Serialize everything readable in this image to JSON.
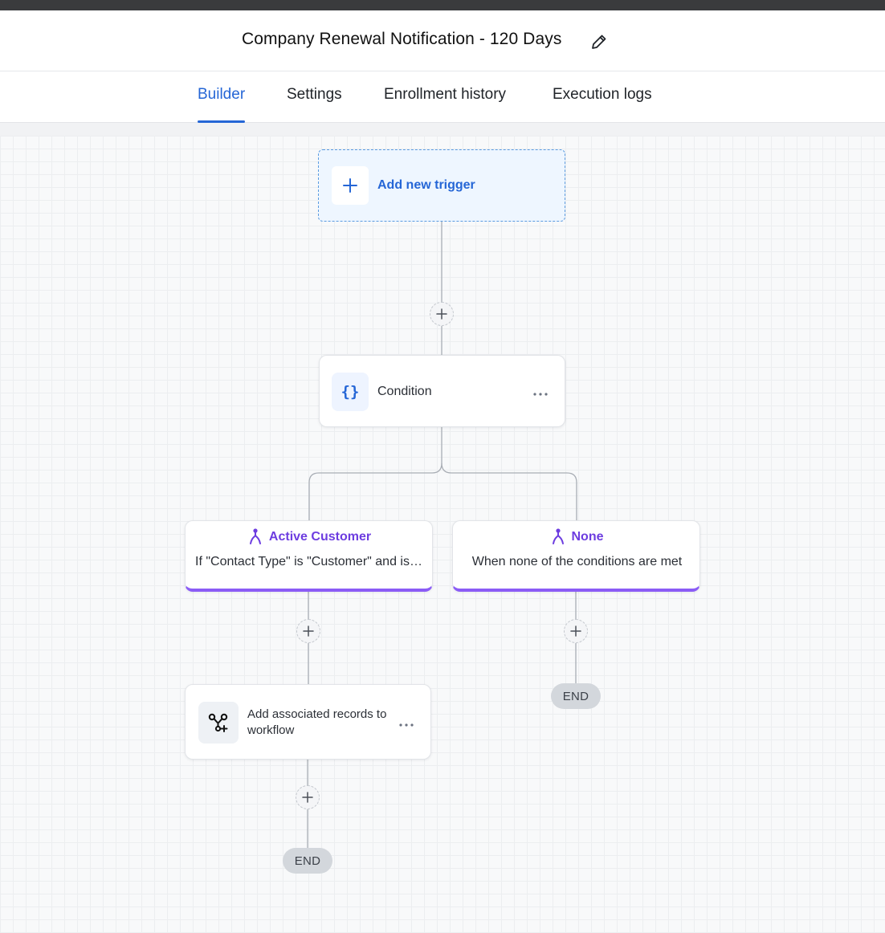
{
  "workflow": {
    "title": "Company Renewal Notification - 120 Days"
  },
  "tabs": [
    {
      "label": "Builder",
      "active": true
    },
    {
      "label": "Settings",
      "active": false
    },
    {
      "label": "Enrollment history",
      "active": false
    },
    {
      "label": "Execution logs",
      "active": false
    }
  ],
  "canvas": {
    "trigger": {
      "label": "Add new trigger",
      "icon": "plus-icon"
    },
    "condition": {
      "label": "Condition",
      "icon": "braces-icon",
      "glyph": "{}"
    },
    "branches": [
      {
        "title": "Active Customer",
        "description": "If \"Contact Type\" is \"Customer\" and is \"Active\"",
        "icon": "branch-icon"
      },
      {
        "title": "None",
        "description": "When none of the conditions are met",
        "icon": "branch-icon"
      }
    ],
    "action": {
      "label": "Add associated records to workflow",
      "icon": "associated-records-icon"
    },
    "end_label": "END"
  },
  "colors": {
    "accent": "#2566d6",
    "branch": "#6d3de0",
    "branch_bar": "#8b5cf6",
    "trigger_bg": "#eef6ff",
    "end_pill": "#d3d7dc",
    "top_bar": "#3a3b3d"
  }
}
